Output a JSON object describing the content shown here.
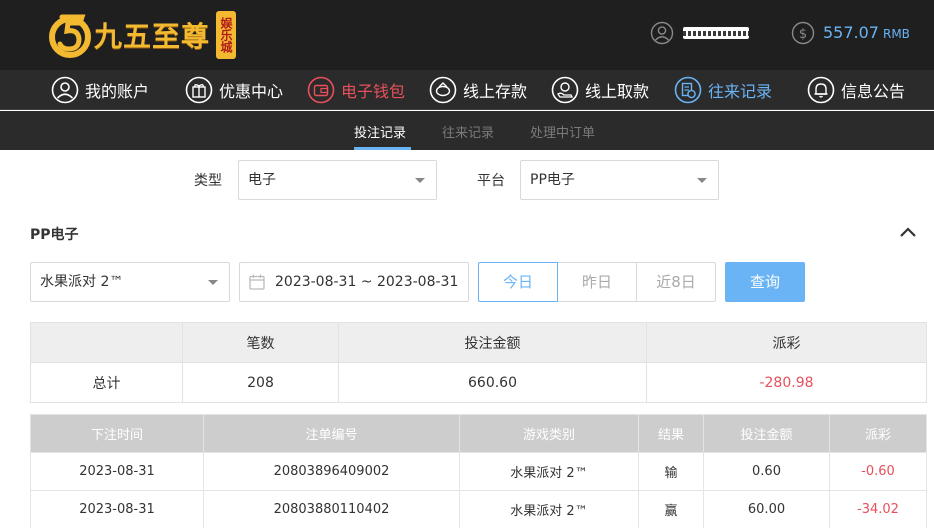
{
  "brand": {
    "name": "九五至尊",
    "badge": "娱乐城"
  },
  "user": {
    "name": "xxxxxxxx",
    "balance": "557.07",
    "currency": "RMB"
  },
  "main_nav": [
    {
      "label": "我的账户",
      "icon": "user-circle-icon"
    },
    {
      "label": "优惠中心",
      "icon": "gift-icon"
    },
    {
      "label": "电子钱包",
      "icon": "wallet-icon"
    },
    {
      "label": "线上存款",
      "icon": "deposit-icon"
    },
    {
      "label": "线上取款",
      "icon": "withdraw-icon"
    },
    {
      "label": "往来记录",
      "icon": "records-icon"
    },
    {
      "label": "信息公告",
      "icon": "bell-icon"
    }
  ],
  "sub_nav": [
    {
      "label": "投注记录"
    },
    {
      "label": "往来记录"
    },
    {
      "label": "处理中订单"
    }
  ],
  "filters": {
    "type_label": "类型",
    "type_value": "电子",
    "platform_label": "平台",
    "platform_value": "PP电子"
  },
  "section": {
    "title": "PP电子",
    "game_value": "水果派对 2™",
    "date_range": "2023-08-31 ~ 2023-08-31",
    "quick_ranges": [
      "今日",
      "昨日",
      "近8日"
    ],
    "query_label": "查询"
  },
  "summary": {
    "headers": [
      "",
      "笔数",
      "投注金额",
      "派彩"
    ],
    "row": {
      "label": "总计",
      "count": "208",
      "bet": "660.60",
      "payout": "-280.98"
    }
  },
  "records": {
    "headers": [
      "下注时间",
      "注单编号",
      "游戏类别",
      "结果",
      "投注金额",
      "派彩"
    ],
    "rows": [
      [
        "2023-08-31",
        "20803896409002",
        "水果派对 2™",
        "输",
        "0.60",
        "-0.60"
      ],
      [
        "2023-08-31",
        "20803880110402",
        "水果派对 2™",
        "赢",
        "60.00",
        "-34.02"
      ]
    ]
  },
  "colors": {
    "accent": "#6ab4f5",
    "negative": "#e8505b",
    "gold": "#f3b931",
    "header_bg": "#1f1f1f",
    "nav_bg": "#2b2b2b"
  }
}
